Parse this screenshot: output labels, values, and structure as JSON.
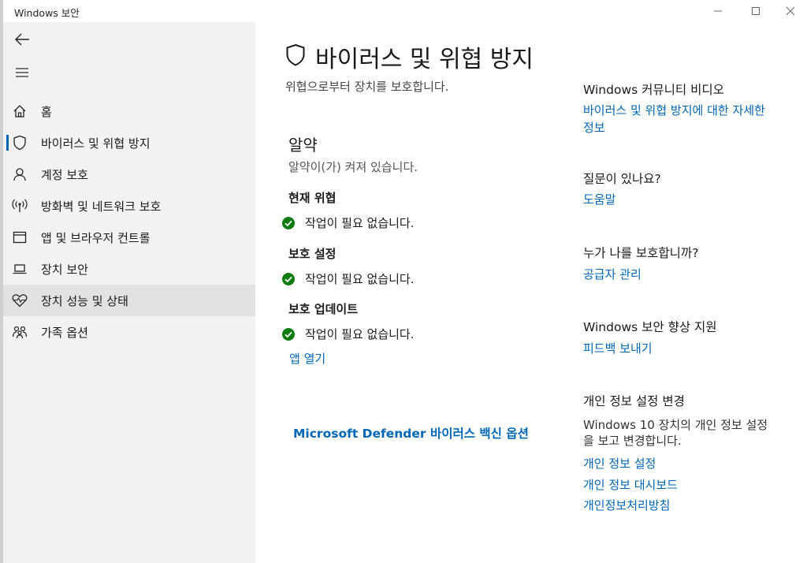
{
  "window": {
    "title": "Windows 보안"
  },
  "sidebar": {
    "items": [
      {
        "label": "홈",
        "icon": "home-icon"
      },
      {
        "label": "바이러스 및 위협 방지",
        "icon": "shield-icon",
        "selected": true
      },
      {
        "label": "계정 보호",
        "icon": "person-icon"
      },
      {
        "label": "방화벽 및 네트워크 보호",
        "icon": "wireless-icon"
      },
      {
        "label": "앱 및 브라우저 컨트롤",
        "icon": "app-window-icon"
      },
      {
        "label": "장치 보안",
        "icon": "laptop-icon"
      },
      {
        "label": "장치 성능 및 상태",
        "icon": "heart-icon"
      },
      {
        "label": "가족 옵션",
        "icon": "family-icon"
      }
    ]
  },
  "main": {
    "title": "바이러스 및 위협 방지",
    "subtitle": "위협으로부터 장치를 보호합니다.",
    "summary": {
      "title": "알약",
      "description": "알약이(가) 켜져 있습니다.",
      "groups": [
        {
          "heading": "현재 위협",
          "status": "작업이 필요 없습니다."
        },
        {
          "heading": "보호 설정",
          "status": "작업이 필요 없습니다."
        },
        {
          "heading": "보호 업데이트",
          "status": "작업이 필요 없습니다."
        }
      ],
      "open_app_link": "앱 열기"
    },
    "defender_link": "Microsoft Defender 바이러스 백신 옵션"
  },
  "right": {
    "community": {
      "heading": "Windows 커뮤니티 비디오",
      "link_line1": "바이러스 및 위협 방지에 대한 자세한",
      "link_line2": "정보"
    },
    "question": {
      "heading": "질문이 있나요?",
      "link": "도움말"
    },
    "protector": {
      "heading": "누가 나를 보호합니까?",
      "link": "공급자 관리"
    },
    "improve": {
      "heading": "Windows 보안 향상 지원",
      "link": "피드백 보내기"
    },
    "privacy": {
      "heading": "개인 정보 설정 변경",
      "text": "Windows 10 장치의 개인 정보 설정을 보고 변경합니다.",
      "links": [
        "개인 정보 설정",
        "개인 정보 대시보드",
        "개인정보처리방침"
      ]
    }
  },
  "colors": {
    "accent": "#0067b8",
    "success": "#107c10",
    "sidebar_bg": "#f2f2f2",
    "selected_bg": "#e2e2e2"
  }
}
